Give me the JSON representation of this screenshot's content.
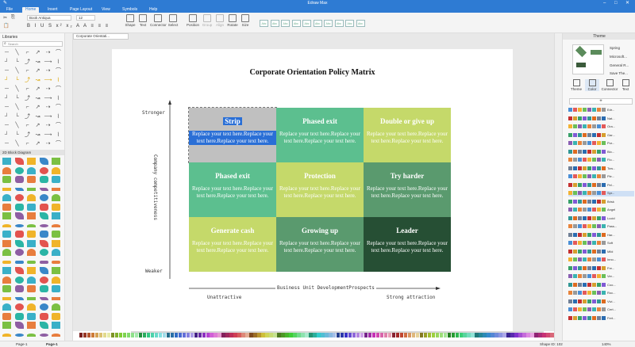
{
  "window": {
    "title": "Edraw Max"
  },
  "menu": {
    "items": [
      "File",
      "Home",
      "Insert",
      "Page Layout",
      "View",
      "Symbols",
      "Help"
    ],
    "active": "Home"
  },
  "toolbar": {
    "font_name": "Book Antiqua",
    "font_size": "12",
    "tools": [
      "Shape",
      "Text",
      "Connector",
      "Select",
      "Position",
      "Group",
      "Align",
      "Rotate",
      "Size"
    ],
    "style_button_label": "Abc"
  },
  "left_panel": {
    "title": "Libraries",
    "search_placeholder": "Search",
    "section_label": "2D Block Diagram"
  },
  "tab": {
    "label": "Corporate Orientati..."
  },
  "diagram": {
    "title": "Corporate Orientation Policy Matrix",
    "y_axis_label": "Company competitiveness",
    "y_top": "Stronger",
    "y_bottom": "Weaker",
    "x_axis_label": "Business Unit DevelopmentProspects",
    "x_left": "Unattractive",
    "x_right": "Strong attraction",
    "cells": [
      {
        "heading": "Strip",
        "body": "Replace your text here.Replace your text here.Replace your text here.",
        "color": "#c0c0c0"
      },
      {
        "heading": "Phased exit",
        "body": "Replace your text here.Replace your text here.Replace your text here.",
        "color": "#5cbf8f"
      },
      {
        "heading": "Double or give up",
        "body": "Replace your text here.Replace your text here.Replace your text here.",
        "color": "#c5d96a"
      },
      {
        "heading": "Phased exit",
        "body": "Replace your text here.Replace your text here.Replace your text here.",
        "color": "#5cbf8f"
      },
      {
        "heading": "Protection",
        "body": "Replace your text here.Replace your text here.Replace your text here.",
        "color": "#c5d96a"
      },
      {
        "heading": "Try harder",
        "body": "Replace your text here.Replace your text here.Replace your text here.",
        "color": "#5a9a6e"
      },
      {
        "heading": "Generate cash",
        "body": "Replace your text here.Replace your text here.Replace your text here.",
        "color": "#c5d96a"
      },
      {
        "heading": "Growing up",
        "body": "Replace your text here.Replace your text here.Replace your text here.",
        "color": "#5a9a6e"
      },
      {
        "heading": "Leader",
        "body": "Replace your text here.Replace your text here.Replace your text here.",
        "color": "#264f34"
      }
    ]
  },
  "right_panel": {
    "title": "Theme",
    "theme_items": [
      "Spring",
      "Microsoft...",
      "General R...",
      "Save The..."
    ],
    "tabs": [
      "Theme",
      "Color",
      "Connector",
      "Text"
    ],
    "color_themes": [
      "Edr...",
      "Nat...",
      "Ora...",
      "Gar...",
      "Pur...",
      "Blo...",
      "Flo...",
      "Tow...",
      "Ple...",
      "Pel...",
      "Spr...",
      "Brisk",
      "Angel",
      "Lucid",
      "Pass...",
      "Har...",
      "Soft",
      "Mild",
      "Inno...",
      "Fre...",
      "Ver...",
      "Coo...",
      "Roc...",
      "Vivi...",
      "Cert...",
      "Fert..."
    ]
  },
  "statusbar": {
    "page_tab": "Page-1",
    "page_current": "Page-1",
    "shape_id": "Shape ID: 102",
    "zoom": "140%"
  }
}
